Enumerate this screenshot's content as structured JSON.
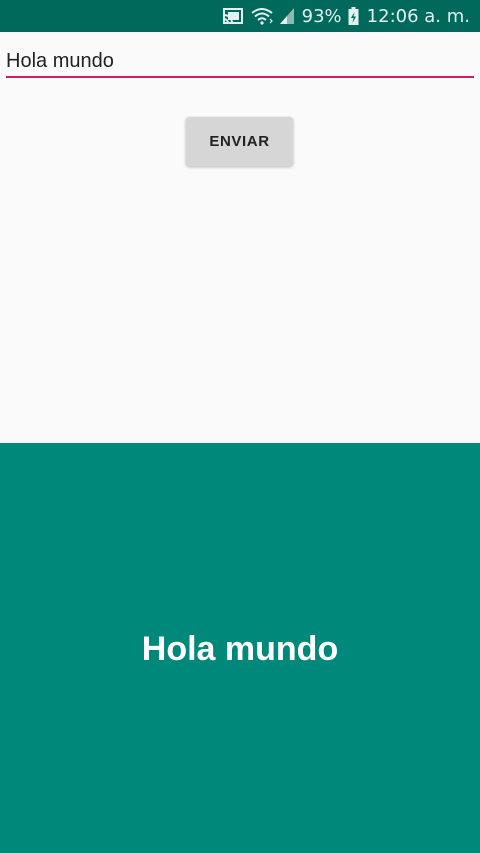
{
  "status_bar": {
    "icons": [
      "cast-icon",
      "wifi-icon",
      "signal-icon",
      "battery-charging-icon"
    ],
    "battery_percent": "93%",
    "time": "12:06 a. m."
  },
  "form": {
    "input_value": "Hola mundo",
    "send_label": "ENVIAR"
  },
  "result": {
    "text": "Hola mundo"
  },
  "colors": {
    "status_bar": "#00695c",
    "accent_underline": "#d81b60",
    "result_panel": "#00897b",
    "button_bg": "#d6d6d6"
  }
}
